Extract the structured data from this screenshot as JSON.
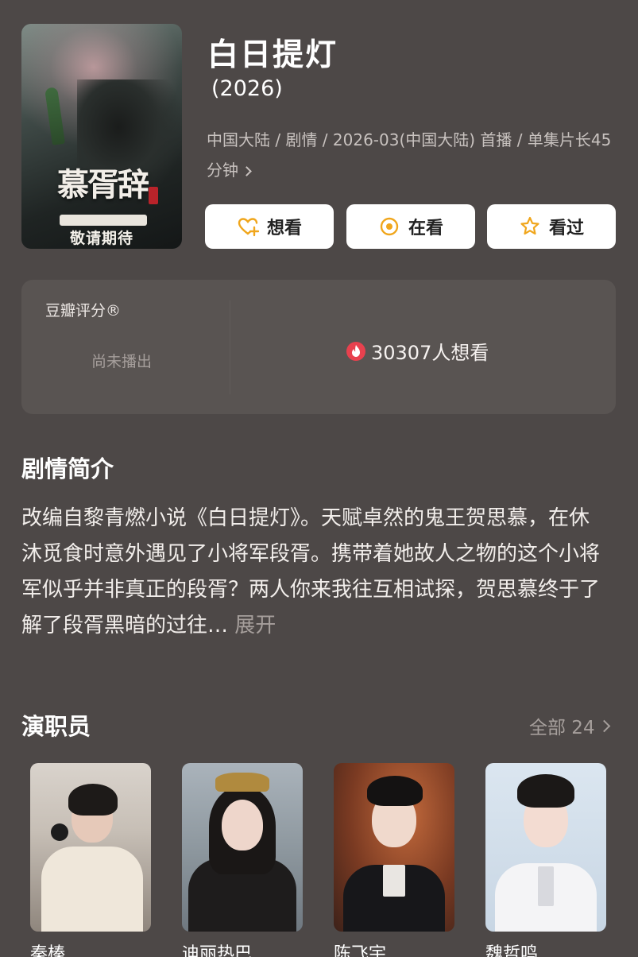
{
  "poster": {
    "title_art": "慕胥辞",
    "release_text": "敬请期待"
  },
  "header": {
    "title": "白日提灯",
    "year": "(2026)",
    "meta_line": "中国大陆 / 剧情 / 2026-03(中国大陆) 首播 / 单集片长45分钟"
  },
  "actions": [
    {
      "label": "想看",
      "icon": "heart-plus-icon"
    },
    {
      "label": "在看",
      "icon": "target-circle-icon"
    },
    {
      "label": "看过",
      "icon": "star-icon"
    }
  ],
  "rating": {
    "label": "豆瓣评分®",
    "status": "尚未播出",
    "want_count_text": "30307人想看",
    "want_icon": "flame-icon"
  },
  "plot": {
    "heading": "剧情简介",
    "text": "改编自黎青燃小说《白日提灯》。天赋卓然的鬼王贺思慕，在休沐觅食时意外遇见了小将军段胥。携带着她故人之物的这个小将军似乎并非真正的段胥？两人你来我往互相试探，贺思慕终于了解了段胥黑暗的过往…",
    "expand_label": "展开"
  },
  "cast": {
    "heading": "演职员",
    "all_label": "全部 24",
    "members": [
      {
        "name": "秦榛"
      },
      {
        "name": "迪丽热巴"
      },
      {
        "name": "陈飞宇"
      },
      {
        "name": "魏哲鸣"
      }
    ]
  },
  "colors": {
    "background": "#4d4847",
    "card": "#595452",
    "button": "#ffffff",
    "accent_yellow": "#f0a61c",
    "flame_red": "#e8414e",
    "muted_text": "#a69f9c"
  }
}
